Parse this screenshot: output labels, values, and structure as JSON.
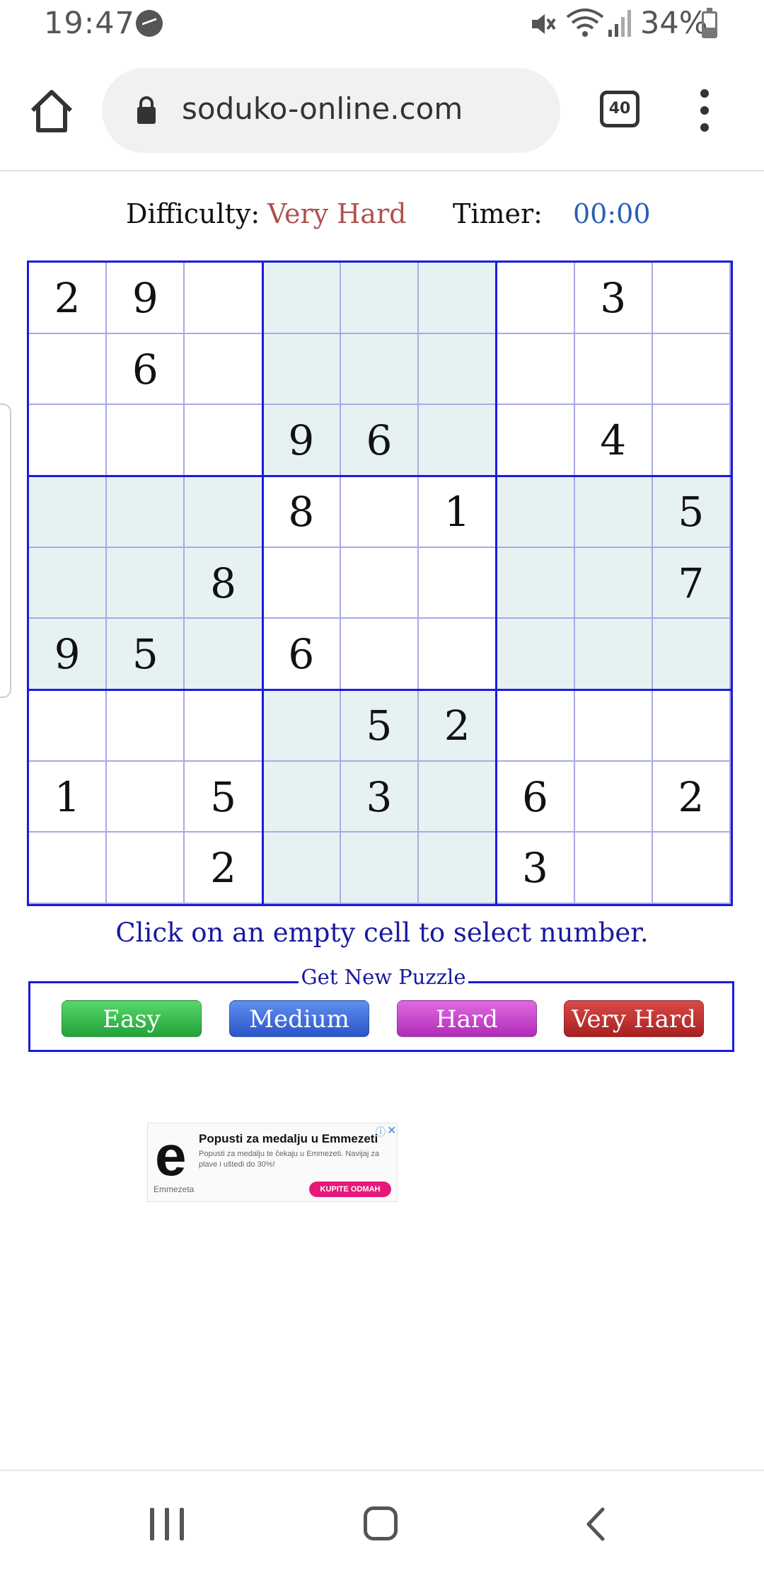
{
  "status_bar": {
    "time": "19:47",
    "battery": "34%"
  },
  "browser": {
    "url": "soduko-online.com",
    "tab_count": "40"
  },
  "game": {
    "difficulty_label": "Difficulty:",
    "difficulty_value": "Very Hard",
    "timer_label": "Timer:",
    "timer_value": "00:00",
    "grid": [
      [
        "2",
        "9",
        "",
        "",
        "",
        "",
        "",
        "3",
        ""
      ],
      [
        "",
        "6",
        "",
        "",
        "",
        "",
        "",
        "",
        ""
      ],
      [
        "",
        "",
        "",
        "9",
        "6",
        "",
        "",
        "4",
        ""
      ],
      [
        "",
        "",
        "",
        "8",
        "",
        "1",
        "",
        "",
        "5"
      ],
      [
        "",
        "",
        "8",
        "",
        "",
        "",
        "",
        "",
        "7"
      ],
      [
        "9",
        "5",
        "",
        "6",
        "",
        "",
        "",
        "",
        ""
      ],
      [
        "",
        "",
        "",
        "",
        "5",
        "2",
        "",
        "",
        ""
      ],
      [
        "1",
        "",
        "5",
        "",
        "3",
        "",
        "6",
        "",
        "2"
      ],
      [
        "",
        "",
        "2",
        "",
        "",
        "",
        "3",
        "",
        ""
      ]
    ],
    "hint": "Click on an empty cell to select number."
  },
  "new_puzzle": {
    "legend": "Get New Puzzle",
    "easy": "Easy",
    "medium": "Medium",
    "hard": "Hard",
    "very_hard": "Very Hard"
  },
  "ad": {
    "logo": "e",
    "title": "Popusti za medalju u Emmezeti",
    "text": "Popusti za medalju te čekaju u Emmezeti. Navijaj za plave i uštedi do 30%!",
    "brand": "Emmezeta",
    "cta": "KUPITE ODMAH"
  },
  "colors": {
    "grid_border": "#1b1be0",
    "shaded_box": "#e6f2f2",
    "difficulty": "#b05050",
    "timer": "#2b5eb5"
  }
}
